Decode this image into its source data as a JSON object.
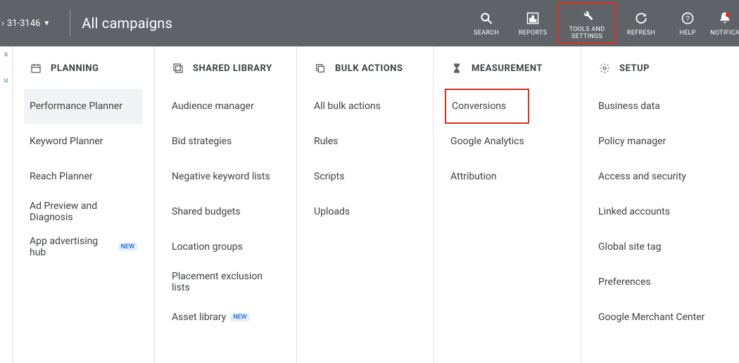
{
  "header": {
    "account_label": "31-3146",
    "title": "All campaigns",
    "tools": {
      "search": "SEARCH",
      "reports": "REPORTS",
      "tools_settings": "TOOLS AND\nSETTINGS",
      "refresh": "REFRESH",
      "help": "HELP",
      "notifications": "NOTIFICA"
    }
  },
  "columns": {
    "planning": {
      "title": "PLANNING",
      "items": [
        {
          "label": "Performance Planner",
          "hover": true
        },
        {
          "label": "Keyword Planner"
        },
        {
          "label": "Reach Planner"
        },
        {
          "label": "Ad Preview and Diagnosis"
        },
        {
          "label": "App advertising hub",
          "new": true
        }
      ]
    },
    "shared": {
      "title": "SHARED LIBRARY",
      "items": [
        {
          "label": "Audience manager"
        },
        {
          "label": "Bid strategies"
        },
        {
          "label": "Negative keyword lists"
        },
        {
          "label": "Shared budgets"
        },
        {
          "label": "Location groups"
        },
        {
          "label": "Placement exclusion lists"
        },
        {
          "label": "Asset library",
          "new": true
        }
      ]
    },
    "bulk": {
      "title": "BULK ACTIONS",
      "items": [
        {
          "label": "All bulk actions"
        },
        {
          "label": "Rules"
        },
        {
          "label": "Scripts"
        },
        {
          "label": "Uploads"
        }
      ]
    },
    "measure": {
      "title": "MEASUREMENT",
      "items": [
        {
          "label": "Conversions",
          "boxed": true
        },
        {
          "label": "Google Analytics"
        },
        {
          "label": "Attribution"
        }
      ]
    },
    "setup": {
      "title": "SETUP",
      "items": [
        {
          "label": "Business data"
        },
        {
          "label": "Policy manager"
        },
        {
          "label": "Access and security"
        },
        {
          "label": "Linked accounts"
        },
        {
          "label": "Global site tag"
        },
        {
          "label": "Preferences"
        },
        {
          "label": "Google Merchant Center"
        }
      ]
    }
  },
  "badge_new_text": "NEW"
}
